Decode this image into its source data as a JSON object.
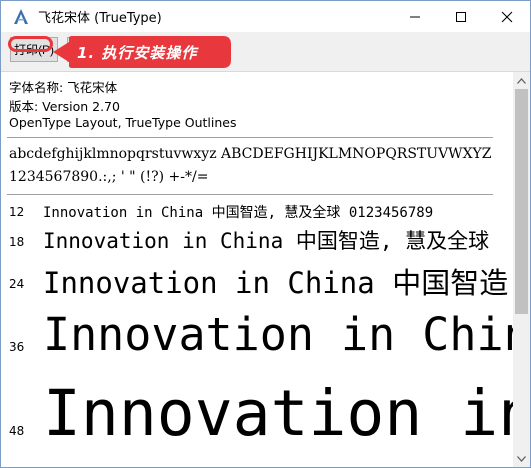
{
  "window": {
    "title": "飞花宋体 (TrueType)"
  },
  "toolbar": {
    "print_label": "打印(P)",
    "install_label": ""
  },
  "annotation": {
    "callout_text": "1. 执行安装操作",
    "color": "#e8383d"
  },
  "font_info": {
    "name_line": "字体名称: 飞花宋体",
    "version_line": "版本: Version 2.70",
    "type_line": "OpenType Layout, TrueType Outlines"
  },
  "charset": {
    "letters": "abcdefghijklmnopqrstuvwxyz ABCDEFGHIJKLMNOPQRSTUVWXYZ",
    "digits": "1234567890.:,; ' \" (!?) +-*/="
  },
  "samples": [
    {
      "size": "12",
      "text": "Innovation in China 中国智造, 慧及全球 0123456789"
    },
    {
      "size": "18",
      "text": "Innovation in China 中国智造, 慧及全球"
    },
    {
      "size": "24",
      "text": "Innovation in China 中国智造,"
    },
    {
      "size": "36",
      "text": "Innovation in China"
    },
    {
      "size": "48",
      "text": "Innovation in C"
    }
  ]
}
